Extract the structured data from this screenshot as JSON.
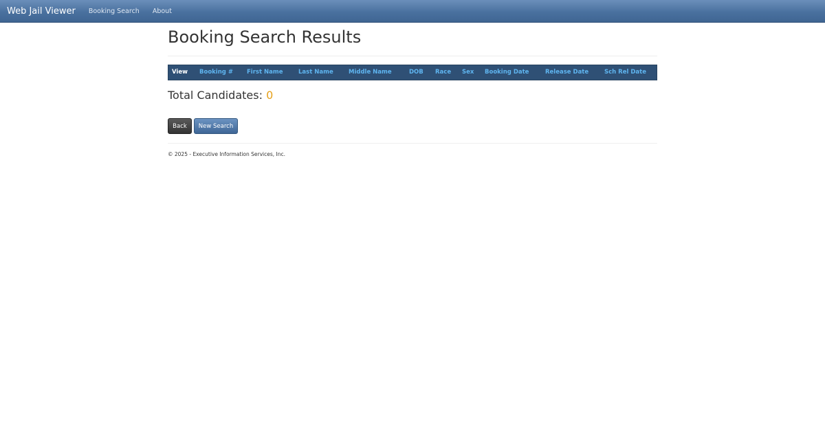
{
  "navbar": {
    "brand": "Web Jail Viewer",
    "links": [
      "Booking Search",
      "About"
    ]
  },
  "page": {
    "title": "Booking Search Results"
  },
  "table": {
    "columns": [
      "View",
      "Booking #",
      "First Name",
      "Last Name",
      "Middle Name",
      "DOB",
      "Race",
      "Sex",
      "Booking Date",
      "Release Date",
      "Sch Rel Date"
    ]
  },
  "results": {
    "total_label": "Total Candidates:",
    "total_count": "0"
  },
  "buttons": {
    "back": "Back",
    "new_search": "New Search"
  },
  "footer": {
    "text": "© 2025 - Executive Information Services, Inc."
  },
  "colors": {
    "navbar": "#4a719f",
    "table_header": "#2f5075",
    "header_link": "#5fb5f0",
    "count": "#e6a11b"
  }
}
